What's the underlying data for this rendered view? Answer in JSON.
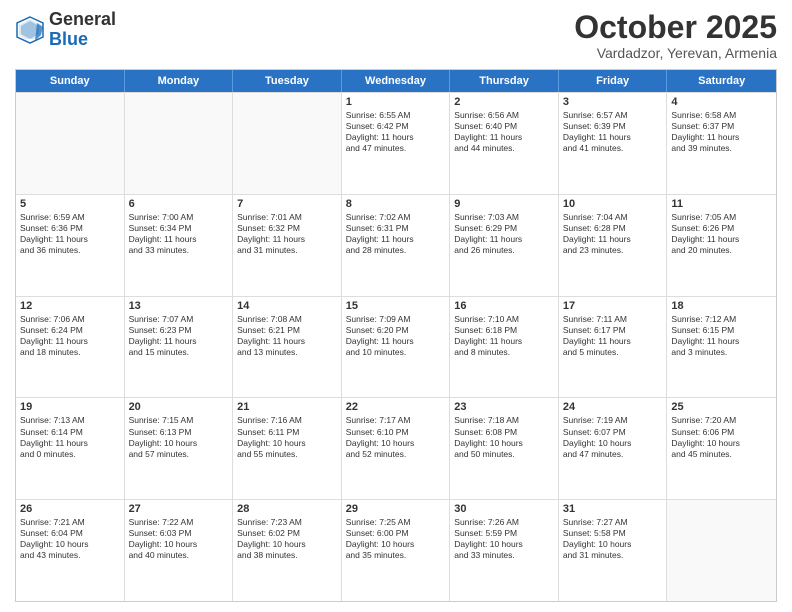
{
  "header": {
    "logo_general": "General",
    "logo_blue": "Blue",
    "month_title": "October 2025",
    "location": "Vardadzor, Yerevan, Armenia"
  },
  "weekdays": [
    "Sunday",
    "Monday",
    "Tuesday",
    "Wednesday",
    "Thursday",
    "Friday",
    "Saturday"
  ],
  "weeks": [
    [
      {
        "day": "",
        "info": ""
      },
      {
        "day": "",
        "info": ""
      },
      {
        "day": "",
        "info": ""
      },
      {
        "day": "1",
        "info": "Sunrise: 6:55 AM\nSunset: 6:42 PM\nDaylight: 11 hours\nand 47 minutes."
      },
      {
        "day": "2",
        "info": "Sunrise: 6:56 AM\nSunset: 6:40 PM\nDaylight: 11 hours\nand 44 minutes."
      },
      {
        "day": "3",
        "info": "Sunrise: 6:57 AM\nSunset: 6:39 PM\nDaylight: 11 hours\nand 41 minutes."
      },
      {
        "day": "4",
        "info": "Sunrise: 6:58 AM\nSunset: 6:37 PM\nDaylight: 11 hours\nand 39 minutes."
      }
    ],
    [
      {
        "day": "5",
        "info": "Sunrise: 6:59 AM\nSunset: 6:36 PM\nDaylight: 11 hours\nand 36 minutes."
      },
      {
        "day": "6",
        "info": "Sunrise: 7:00 AM\nSunset: 6:34 PM\nDaylight: 11 hours\nand 33 minutes."
      },
      {
        "day": "7",
        "info": "Sunrise: 7:01 AM\nSunset: 6:32 PM\nDaylight: 11 hours\nand 31 minutes."
      },
      {
        "day": "8",
        "info": "Sunrise: 7:02 AM\nSunset: 6:31 PM\nDaylight: 11 hours\nand 28 minutes."
      },
      {
        "day": "9",
        "info": "Sunrise: 7:03 AM\nSunset: 6:29 PM\nDaylight: 11 hours\nand 26 minutes."
      },
      {
        "day": "10",
        "info": "Sunrise: 7:04 AM\nSunset: 6:28 PM\nDaylight: 11 hours\nand 23 minutes."
      },
      {
        "day": "11",
        "info": "Sunrise: 7:05 AM\nSunset: 6:26 PM\nDaylight: 11 hours\nand 20 minutes."
      }
    ],
    [
      {
        "day": "12",
        "info": "Sunrise: 7:06 AM\nSunset: 6:24 PM\nDaylight: 11 hours\nand 18 minutes."
      },
      {
        "day": "13",
        "info": "Sunrise: 7:07 AM\nSunset: 6:23 PM\nDaylight: 11 hours\nand 15 minutes."
      },
      {
        "day": "14",
        "info": "Sunrise: 7:08 AM\nSunset: 6:21 PM\nDaylight: 11 hours\nand 13 minutes."
      },
      {
        "day": "15",
        "info": "Sunrise: 7:09 AM\nSunset: 6:20 PM\nDaylight: 11 hours\nand 10 minutes."
      },
      {
        "day": "16",
        "info": "Sunrise: 7:10 AM\nSunset: 6:18 PM\nDaylight: 11 hours\nand 8 minutes."
      },
      {
        "day": "17",
        "info": "Sunrise: 7:11 AM\nSunset: 6:17 PM\nDaylight: 11 hours\nand 5 minutes."
      },
      {
        "day": "18",
        "info": "Sunrise: 7:12 AM\nSunset: 6:15 PM\nDaylight: 11 hours\nand 3 minutes."
      }
    ],
    [
      {
        "day": "19",
        "info": "Sunrise: 7:13 AM\nSunset: 6:14 PM\nDaylight: 11 hours\nand 0 minutes."
      },
      {
        "day": "20",
        "info": "Sunrise: 7:15 AM\nSunset: 6:13 PM\nDaylight: 10 hours\nand 57 minutes."
      },
      {
        "day": "21",
        "info": "Sunrise: 7:16 AM\nSunset: 6:11 PM\nDaylight: 10 hours\nand 55 minutes."
      },
      {
        "day": "22",
        "info": "Sunrise: 7:17 AM\nSunset: 6:10 PM\nDaylight: 10 hours\nand 52 minutes."
      },
      {
        "day": "23",
        "info": "Sunrise: 7:18 AM\nSunset: 6:08 PM\nDaylight: 10 hours\nand 50 minutes."
      },
      {
        "day": "24",
        "info": "Sunrise: 7:19 AM\nSunset: 6:07 PM\nDaylight: 10 hours\nand 47 minutes."
      },
      {
        "day": "25",
        "info": "Sunrise: 7:20 AM\nSunset: 6:06 PM\nDaylight: 10 hours\nand 45 minutes."
      }
    ],
    [
      {
        "day": "26",
        "info": "Sunrise: 7:21 AM\nSunset: 6:04 PM\nDaylight: 10 hours\nand 43 minutes."
      },
      {
        "day": "27",
        "info": "Sunrise: 7:22 AM\nSunset: 6:03 PM\nDaylight: 10 hours\nand 40 minutes."
      },
      {
        "day": "28",
        "info": "Sunrise: 7:23 AM\nSunset: 6:02 PM\nDaylight: 10 hours\nand 38 minutes."
      },
      {
        "day": "29",
        "info": "Sunrise: 7:25 AM\nSunset: 6:00 PM\nDaylight: 10 hours\nand 35 minutes."
      },
      {
        "day": "30",
        "info": "Sunrise: 7:26 AM\nSunset: 5:59 PM\nDaylight: 10 hours\nand 33 minutes."
      },
      {
        "day": "31",
        "info": "Sunrise: 7:27 AM\nSunset: 5:58 PM\nDaylight: 10 hours\nand 31 minutes."
      },
      {
        "day": "",
        "info": ""
      }
    ]
  ]
}
